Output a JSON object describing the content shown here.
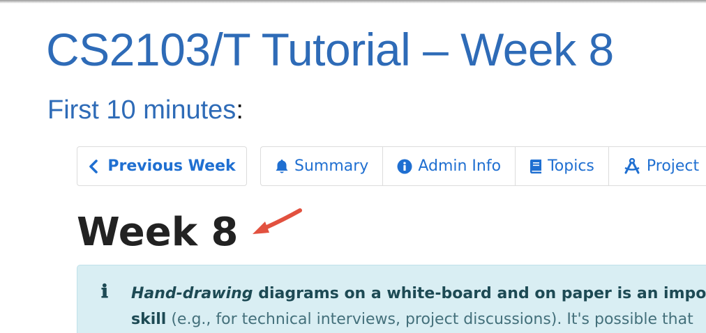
{
  "slide": {
    "title": "CS2103/T Tutorial – Week 8",
    "subtitle_blue": "First 10 minutes",
    "subtitle_colon": ":"
  },
  "nav": {
    "previous_label": "Previous Week",
    "items": [
      {
        "label": "Summary",
        "icon": "bell-icon"
      },
      {
        "label": "Admin Info",
        "icon": "info-circle-icon"
      },
      {
        "label": "Topics",
        "icon": "book-icon"
      },
      {
        "label": "Project",
        "icon": "compass-drafting-icon"
      }
    ]
  },
  "page": {
    "heading": "Week 8"
  },
  "info": {
    "icon_glyph": "ℹ",
    "line1_italic": "Hand-drawing",
    "line1_bold": " diagrams on a white-board and on paper is an import",
    "line2_bold": "skill",
    "line2_rest": " (e.g., for technical interviews, project discussions). It's possible that"
  },
  "colors": {
    "title_blue": "#2e6bb7",
    "link_blue": "#1f6fd1",
    "info_bg": "#d9eef3",
    "arrow_red": "#e2513f"
  }
}
